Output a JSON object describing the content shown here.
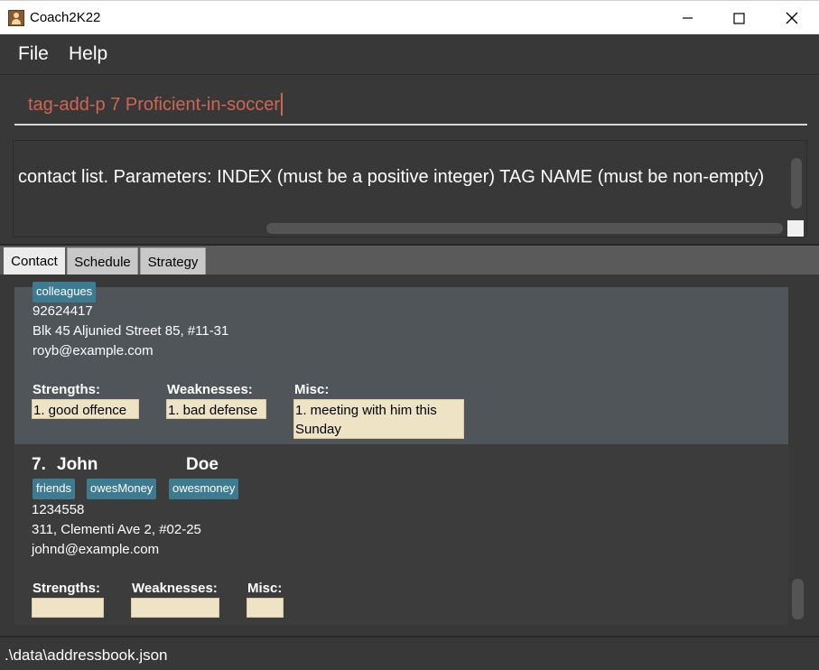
{
  "window": {
    "title": "Coach2K22",
    "app_icon": "contact-book-icon",
    "controls": [
      "minimize-icon",
      "maximize-icon",
      "close-icon"
    ]
  },
  "menu": {
    "file": "File",
    "help": "Help"
  },
  "command": {
    "value": "tag-add-p 7 Proficient-in-soccer"
  },
  "result": {
    "text": "contact list. Parameters: INDEX (must be a positive integer) TAG NAME (must be non-empty)"
  },
  "tabs": [
    {
      "label": "Contact",
      "active": true
    },
    {
      "label": "Schedule",
      "active": false
    },
    {
      "label": "Strategy",
      "active": false
    }
  ],
  "persons": [
    {
      "tags": [
        "colleagues"
      ],
      "phone": "92624417",
      "address": "Blk 45 Aljunied Street 85, #11-31",
      "email": "royb@example.com",
      "strengths_label": "Strengths:",
      "weaknesses_label": "Weaknesses:",
      "misc_label": "Misc:",
      "strengths": "1. good offence",
      "weaknesses": "1. bad defense",
      "misc_line1": "1. meeting with him this",
      "misc_line2": "Sunday"
    },
    {
      "index": "7.",
      "first_name": "John",
      "last_name": "Doe",
      "tags": [
        "friends",
        "owesMoney",
        "owesmoney"
      ],
      "phone": "1234558",
      "address": "311, Clementi Ave 2, #02-25",
      "email": "johnd@example.com",
      "strengths_label": "Strengths:",
      "weaknesses_label": "Weaknesses:",
      "misc_label": "Misc:",
      "strengths": "",
      "weaknesses": "",
      "misc": ""
    }
  ],
  "status": {
    "path": ".\\data\\addressbook.json"
  },
  "colors": {
    "background": "#383838",
    "command_text": "#d06651",
    "tag": "#3e7b91",
    "selected_card": "#4f5559",
    "note_bg": "#eee3c5"
  }
}
